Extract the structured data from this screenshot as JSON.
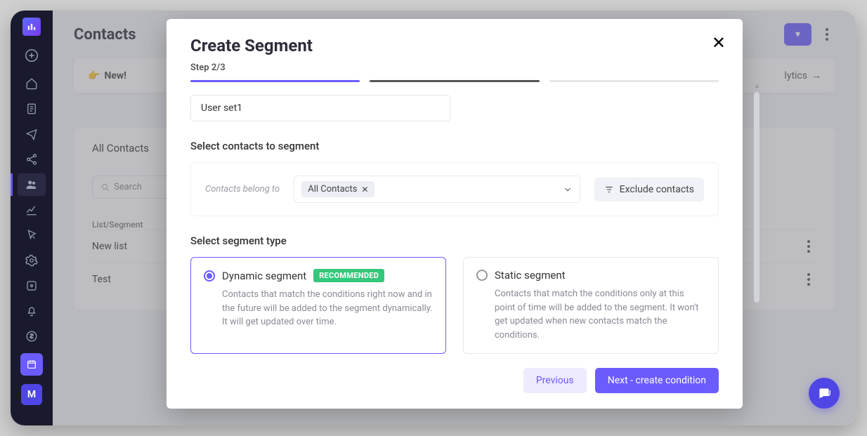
{
  "sidebar": {
    "avatar_letter": "M"
  },
  "header": {
    "title": "Contacts",
    "analytics_link": "lytics"
  },
  "banner": {
    "new_label": "New!"
  },
  "content": {
    "tab": "All Contacts",
    "search_placeholder": "Search",
    "column_header": "List/Segment",
    "rows": [
      "New list",
      "Test"
    ]
  },
  "modal": {
    "title": "Create Segment",
    "step_label": "Step 2/3",
    "segment_name": "User set1",
    "section_contacts": "Select contacts to segment",
    "belong_label": "Contacts belong to",
    "chip_label": "All Contacts",
    "exclude_label": "Exclude contacts",
    "section_type": "Select segment type",
    "dynamic": {
      "title": "Dynamic segment",
      "badge": "RECOMMENDED",
      "desc": "Contacts that match the conditions right now and in the future will be added to the segment dynamically. It will get updated over time."
    },
    "static_seg": {
      "title": "Static segment",
      "desc": "Contacts that match the conditions only at this point of time will be added to the segment. It won't get updated when new contacts match the conditions."
    },
    "prev_btn": "Previous",
    "next_btn": "Next - create condition"
  }
}
